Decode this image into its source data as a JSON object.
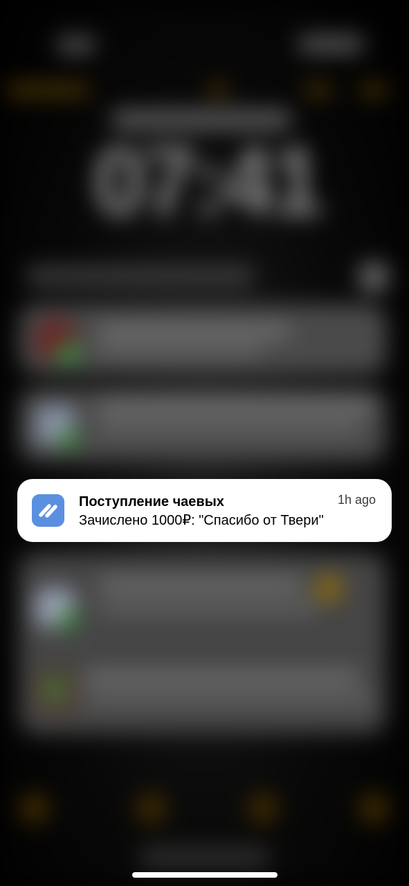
{
  "lock_screen": {
    "clock_text": "07:41"
  },
  "notification": {
    "app_icon": "tips-app-icon",
    "title": "Поступление чаевых",
    "time": "1h ago",
    "body": "Зачислено 1000₽: \"Спасибо от Твери\""
  },
  "colors": {
    "accent_icon_bg": "#5b8fe0",
    "notification_bg": "#ffffff",
    "background": "#000000"
  }
}
